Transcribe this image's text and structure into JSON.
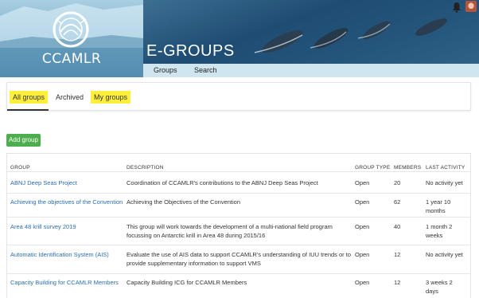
{
  "brand": {
    "logo_text": "CCAMLR",
    "section_title": "E-GROUPS"
  },
  "subnav": {
    "items": [
      "Groups",
      "Search"
    ]
  },
  "header_icons": [
    "bell-icon",
    "user-avatar"
  ],
  "tabs": [
    "All groups",
    "Archived",
    "My groups"
  ],
  "actions": {
    "add_group": "Add group"
  },
  "table": {
    "columns": [
      "GROUP",
      "DESCRIPTION",
      "GROUP TYPE",
      "MEMBERS",
      "LAST ACTIVITY"
    ],
    "rows": [
      {
        "group": "ABNJ Deep Seas Project",
        "description": [
          "Coordination of CCAMLR's contributions to the ABNJ Deep Seas Project"
        ],
        "type": "Open",
        "members": "20",
        "activity": [
          "No activity yet"
        ]
      },
      {
        "group": "Achieving the objectives of the Convention",
        "description": [
          "Achieving the Objectives of the Convention"
        ],
        "type": "Open",
        "members": "62",
        "activity": [
          "1 year 10",
          "months"
        ]
      },
      {
        "group": "Area 48 krill survey 2019",
        "description": [
          "This group will work towards the development of a multi-national field program",
          "focussing on Antarctic krill in Area 48 during 2015/16"
        ],
        "type": "Open",
        "members": "40",
        "activity": [
          "1 month 2",
          "weeks"
        ]
      },
      {
        "group": "Automatic Identification System (AIS)",
        "description": [
          "Evaluate the use of AIS data to support CCAMLR's understanding of IUU trends or to",
          "provide supplementary information to support VMS"
        ],
        "type": "Open",
        "members": "12",
        "activity": [
          "No activity yet"
        ]
      },
      {
        "group": "Capacity Building for CCAMLR Members",
        "description": [
          "Capacity Building ICG for CCAMLR Members"
        ],
        "type": "Open",
        "members": "12",
        "activity": [
          "3 weeks 2",
          "days"
        ]
      }
    ]
  },
  "colors": {
    "highlight": "#ffef3a",
    "link": "#2a6db3",
    "add_button": "#4cae4c",
    "subnav_bg": "#cfe6f1"
  }
}
